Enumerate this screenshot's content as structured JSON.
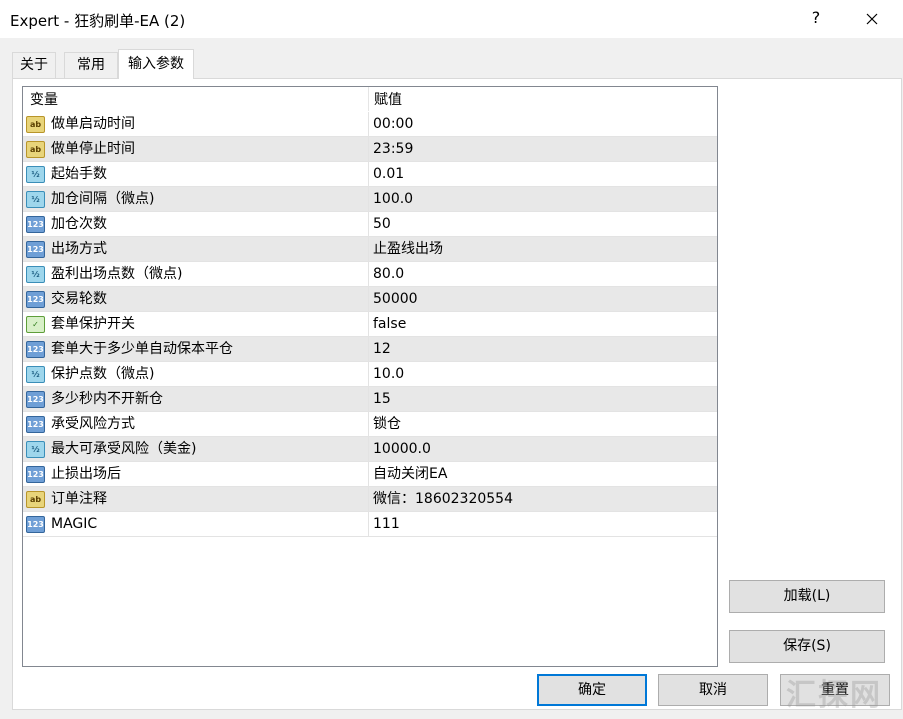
{
  "window": {
    "title": "Expert - 狂豹刷单-EA (2)",
    "help_glyph": "?"
  },
  "tabs": [
    {
      "label": "关于",
      "active": false
    },
    {
      "label": "常用",
      "active": false
    },
    {
      "label": "输入参数",
      "active": true
    }
  ],
  "grid": {
    "columns": [
      "变量",
      "赋值"
    ],
    "rows": [
      {
        "type": "string",
        "icon": "ab",
        "name": "做单启动时间",
        "value": "00:00"
      },
      {
        "type": "string",
        "icon": "ab",
        "name": "做单停止时间",
        "value": "23:59"
      },
      {
        "type": "double",
        "icon": "½",
        "name": "起始手数",
        "value": "0.01"
      },
      {
        "type": "double",
        "icon": "½",
        "name": "加仓间隔（微点)",
        "value": "100.0"
      },
      {
        "type": "int",
        "icon": "123",
        "name": "加仓次数",
        "value": "50"
      },
      {
        "type": "int",
        "icon": "123",
        "name": "出场方式",
        "value": "止盈线出场"
      },
      {
        "type": "double",
        "icon": "½",
        "name": "盈利出场点数（微点)",
        "value": "80.0"
      },
      {
        "type": "int",
        "icon": "123",
        "name": "交易轮数",
        "value": "50000"
      },
      {
        "type": "bool",
        "icon": "✓",
        "name": "套单保护开关",
        "value": "false"
      },
      {
        "type": "int",
        "icon": "123",
        "name": "套单大于多少单自动保本平仓",
        "value": "12"
      },
      {
        "type": "double",
        "icon": "½",
        "name": "保护点数（微点)",
        "value": "10.0"
      },
      {
        "type": "int",
        "icon": "123",
        "name": "多少秒内不开新仓",
        "value": "15"
      },
      {
        "type": "int",
        "icon": "123",
        "name": "承受风险方式",
        "value": "锁仓"
      },
      {
        "type": "double",
        "icon": "½",
        "name": "最大可承受风险（美金)",
        "value": "10000.0"
      },
      {
        "type": "int",
        "icon": "123",
        "name": "止损出场后",
        "value": "自动关闭EA"
      },
      {
        "type": "string",
        "icon": "ab",
        "name": "订单注释",
        "value": "微信：18602320554"
      },
      {
        "type": "int",
        "icon": "123",
        "name": "MAGIC",
        "value": "111"
      }
    ]
  },
  "buttons": {
    "load": "加载(L)",
    "save": "保存(S)",
    "ok": "确定",
    "cancel": "取消",
    "reset": "重置"
  },
  "watermark": "汇探网",
  "colors": {
    "focus_border": "#0078d7",
    "alt_row": "#e8e8e8"
  }
}
